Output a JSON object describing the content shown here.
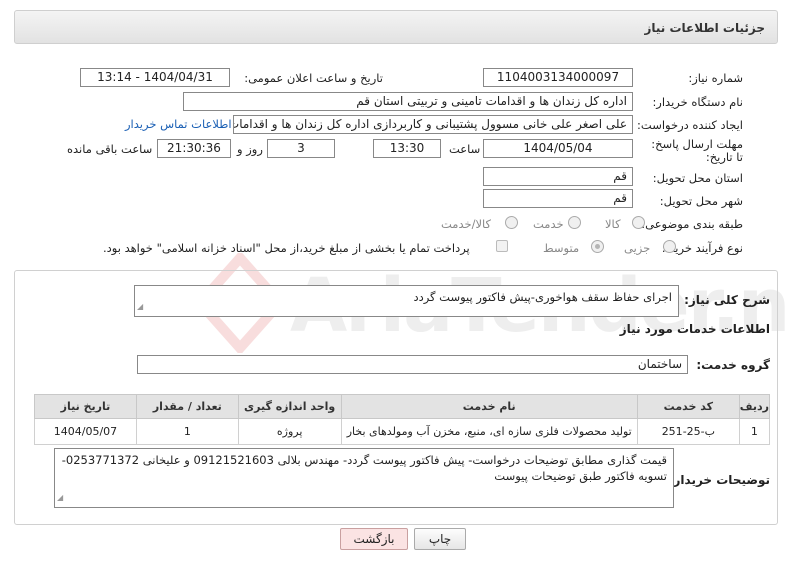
{
  "header": {
    "title": "جزئیات اطلاعات نیاز"
  },
  "fields": {
    "need_number_label": "شماره نیاز:",
    "need_number": "1104003134000097",
    "announce_label": "تاریخ و ساعت اعلان عمومی:",
    "announce_value": "1404/04/31 - 13:14",
    "buyer_org_label": "نام دستگاه خریدار:",
    "buyer_org": "اداره کل زندان ها و اقدامات تامینی و تربیتی استان قم",
    "requester_label": "ایجاد کننده درخواست:",
    "requester": "علی اصغر علی خانی مسوول پشتیبانی و کاربردازی اداره کل زندان ها و اقدامات تامینی و تربیتی استان قم",
    "contact_link": "اطلاعات تماس خریدار",
    "deadline_label": "مهلت ارسال پاسخ: تا تاریخ:",
    "deadline_date": "1404/05/04",
    "time_label": "ساعت",
    "deadline_time": "13:30",
    "days_value": "3",
    "days_label": "روز و",
    "remaining_time": "21:30:36",
    "remaining_label": "ساعت باقی مانده",
    "province_label": "استان محل تحویل:",
    "province": "قم",
    "city_label": "شهر محل تحویل:",
    "city": "قم",
    "category_label": "طبقه بندی موضوعی:",
    "category_options": [
      "کالا",
      "خدمت",
      "کالا/خدمت"
    ],
    "process_label": "نوع فرآیند خرید :",
    "process_options": [
      "جزیی",
      "متوسط"
    ],
    "payment_note": "پرداخت تمام یا بخشی از مبلغ خرید،از محل \"اسناد خزانه اسلامی\" خواهد بود."
  },
  "details": {
    "summary_label": "شرح کلی نیاز:",
    "summary": "اجرای حفاظ سقف هواخوری-پیش فاکتور پیوست گردد",
    "services_title": "اطلاعات خدمات مورد نیاز",
    "service_group_label": "گروه خدمت:",
    "service_group": "ساختمان",
    "table_headers": [
      "ردیف",
      "کد خدمت",
      "نام خدمت",
      "واحد اندازه گیری",
      "تعداد / مقدار",
      "تاریخ نیاز"
    ],
    "table_rows": [
      [
        "1",
        "ب-25-251",
        "تولید محصولات فلزی سازه ای، منبع، مخزن آب ومولدهای بخار",
        "پروژه",
        "1",
        "1404/05/07"
      ]
    ],
    "buyer_notes_label": "توضیحات خریدار:",
    "buyer_notes": "قیمت گذاری مطابق توضیحات درخواست- پیش فاکتور پیوست گردد- مهندس بلالی 09121521603 و علیخانی 0253771372- تسویه فاکتور طبق توضیحات پیوست"
  },
  "buttons": {
    "print": "چاپ",
    "back": "بازگشت"
  },
  "watermark": {
    "text": "AriaTender.neT"
  }
}
